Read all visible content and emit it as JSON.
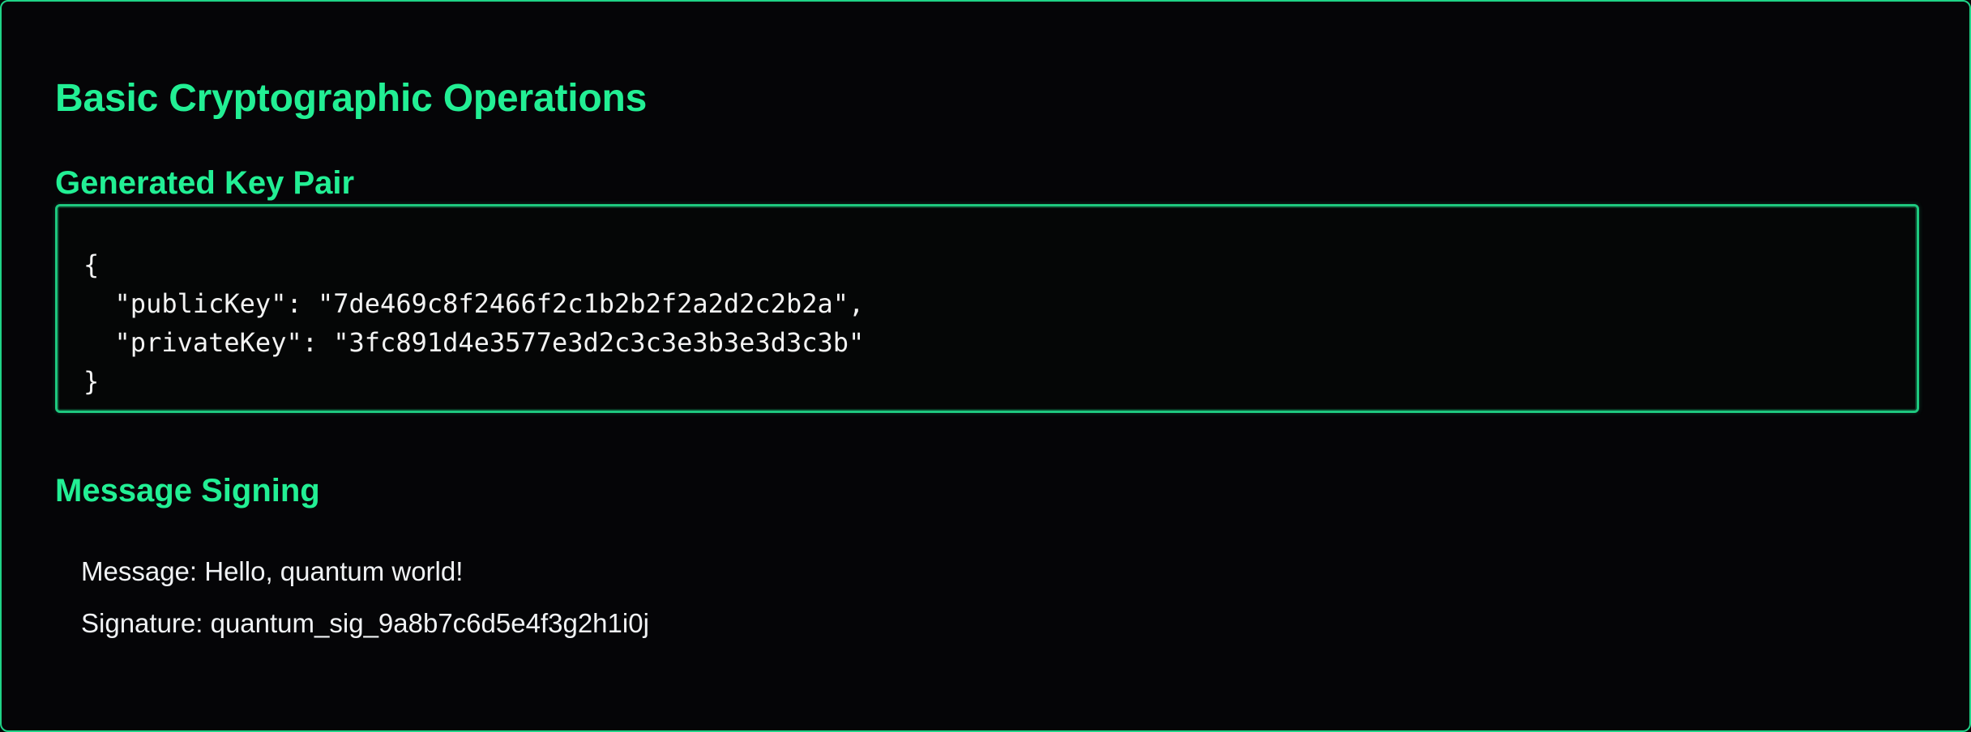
{
  "page": {
    "title": "Basic Cryptographic Operations"
  },
  "key_pair": {
    "heading": "Generated Key Pair",
    "json_text": "{\n  \"publicKey\": \"7de469c8f2466f2c1b2b2f2a2d2c2b2a\",\n  \"privateKey\": \"3fc891d4e3577e3d2c3c3e3b3e3d3c3b\"\n}"
  },
  "signing": {
    "heading": "Message Signing",
    "message_line": "Message: Hello, quantum world!",
    "signature_line": "Signature: quantum_sig_9a8b7c6d5e4f3g2h1i0j"
  },
  "colors": {
    "accent": "#22ef94",
    "border": "#1fd487",
    "background": "#050507",
    "text": "#f0f2f4"
  }
}
